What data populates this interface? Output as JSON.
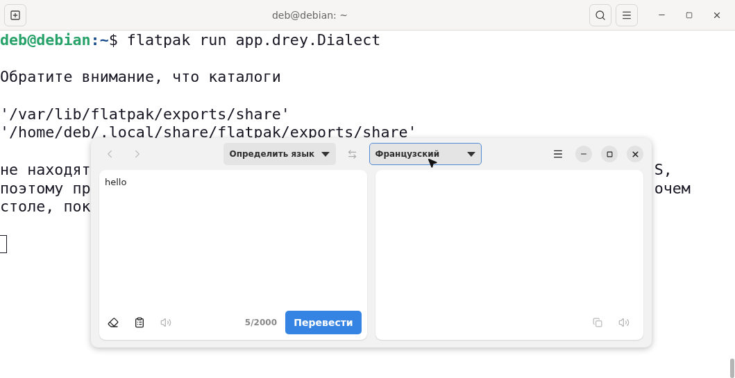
{
  "terminal": {
    "title": "deb@debian: ~",
    "prompt": {
      "user_host": "deb@debian",
      "path": ":~",
      "symbol": "$",
      "command": "flatpak run app.drey.Dialect"
    },
    "paragraphs": [
      [
        {
          "text": "Обратите внимание, что каталоги"
        }
      ],
      [
        {
          "text": "'/var/lib/flatpak/exports/share'"
        },
        {
          "text": "'/home/deb/.local/share/flatpak/exports/share'"
        }
      ],
      [
        {
          "text": "не находят",
          "tail": "S,"
        },
        {
          "text": "поэтому пр",
          "tail": "очем"
        },
        {
          "text": "столе, пок"
        }
      ]
    ]
  },
  "dialect": {
    "nav": [
      {
        "kind": "back",
        "disabled": true
      },
      {
        "kind": "forward",
        "disabled": true
      }
    ],
    "source_language": {
      "label": "Определить язык",
      "focused": false
    },
    "target_language": {
      "label": "Французский",
      "focused": true
    },
    "source": {
      "value": "hello",
      "counter": "5/2000",
      "speak_disabled": true,
      "translate_button": "Перевести"
    },
    "target": {
      "copy_disabled": true,
      "speak_disabled": true
    }
  }
}
